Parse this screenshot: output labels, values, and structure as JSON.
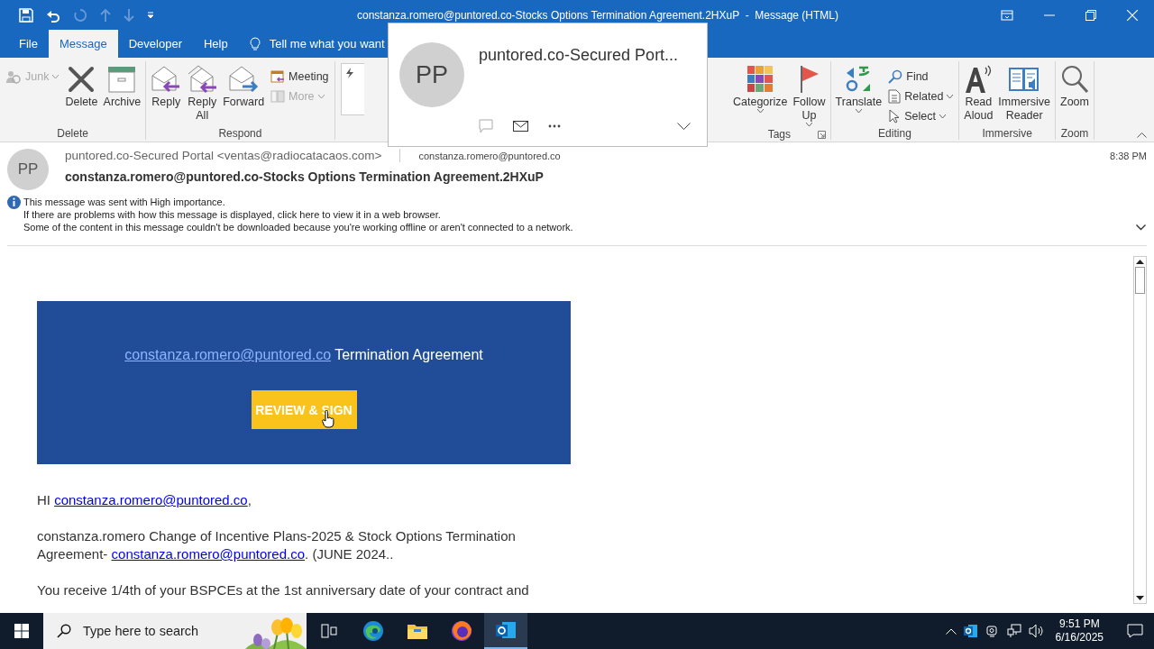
{
  "title_bar": {
    "title": "constanza.romero@puntored.co-Stocks Options Termination Agreement.2HXuP  -  Message (HTML)"
  },
  "tabs": [
    {
      "label": "File",
      "selected": false
    },
    {
      "label": "Message",
      "selected": true
    },
    {
      "label": "Developer",
      "selected": false
    },
    {
      "label": "Help",
      "selected": false
    }
  ],
  "tell_me": {
    "placeholder": "Tell me what you want"
  },
  "ribbon": {
    "left_groups": [
      {
        "label": "Delete",
        "items": [
          {
            "label": "Junk",
            "kind": "small",
            "disabled": true,
            "dropdown": true
          },
          {
            "label": "Delete",
            "kind": "large",
            "disabled": false,
            "dropdown": false
          },
          {
            "label": "Archive",
            "kind": "large",
            "disabled": false,
            "dropdown": false
          }
        ]
      },
      {
        "label": "Respond",
        "items": [
          {
            "label": "Reply",
            "kind": "large",
            "disabled": false,
            "dropdown": false
          },
          {
            "label": "Reply All",
            "kind": "large",
            "disabled": false,
            "dropdown": false
          },
          {
            "label": "Forward",
            "kind": "large",
            "disabled": false,
            "dropdown": false
          },
          {
            "label": "Meeting",
            "kind": "small",
            "disabled": false,
            "dropdown": false
          },
          {
            "label": "More",
            "kind": "small",
            "disabled": true,
            "dropdown": true
          }
        ]
      }
    ],
    "right_groups": [
      {
        "label": "Tags",
        "dialog_launcher": true,
        "items": [
          {
            "label": "Categorize",
            "kind": "large",
            "disabled": false,
            "dropdown": true
          },
          {
            "label": "Follow Up",
            "kind": "large",
            "disabled": false,
            "dropdown": true
          }
        ]
      },
      {
        "label": "Editing",
        "items": [
          {
            "label": "Translate",
            "kind": "large",
            "disabled": false,
            "dropdown": true
          },
          {
            "label": "Find",
            "kind": "small",
            "disabled": false,
            "dropdown": false
          },
          {
            "label": "Related",
            "kind": "small",
            "disabled": false,
            "dropdown": true
          },
          {
            "label": "Select",
            "kind": "small",
            "disabled": false,
            "dropdown": true
          }
        ]
      },
      {
        "label": "Immersive",
        "items": [
          {
            "label": "Read Aloud",
            "kind": "large",
            "disabled": false,
            "dropdown": false
          },
          {
            "label": "Immersive Reader",
            "kind": "large",
            "disabled": false,
            "dropdown": false
          }
        ]
      },
      {
        "label": "Zoom",
        "items": [
          {
            "label": "Zoom",
            "kind": "large",
            "disabled": false,
            "dropdown": false
          }
        ]
      }
    ]
  },
  "contact_card": {
    "initials": "PP",
    "name": "puntored.co-Secured Port..."
  },
  "message": {
    "initials": "PP",
    "sender": "puntored.co-Secured Portal <ventas@radiocatacaos.com>",
    "to": "constanza.romero@puntored.co",
    "time": "8:38 PM",
    "subject": "constanza.romero@puntored.co-Stocks Options Termination Agreement.2HXuP",
    "info": [
      "This message was sent with High importance.",
      "If there are problems with how this message is displayed, click here to view it in a web browser.",
      "Some of the content in this message couldn't be downloaded because you're working offline or aren't connected to a network."
    ]
  },
  "body": {
    "banner": {
      "link": "constanza.romero@puntored.co",
      "title": " Termination Agreement",
      "button": "REVIEW & SIGN"
    },
    "paragraphs": [
      {
        "parts": [
          {
            "kind": "text",
            "text": "HI "
          },
          {
            "kind": "link",
            "text": "constanza.romero@puntored.co"
          },
          {
            "kind": "text",
            "text": ","
          }
        ]
      },
      {
        "parts": [
          {
            "kind": "text",
            "text": "constanza.romero Change of Incentive Plans-2025 & Stock Options Termination Agreement- "
          },
          {
            "kind": "link",
            "text": "constanza.romero@puntored.co"
          },
          {
            "kind": "text",
            "text": ". (JUNE 2024.."
          }
        ]
      },
      {
        "parts": [
          {
            "kind": "text",
            "text": "You receive 1/4th of your BSPCEs at the 1st anniversary date of your contract and"
          }
        ]
      }
    ]
  },
  "taskbar": {
    "search": {
      "placeholder": "Type here to search"
    },
    "apps": [
      {
        "selected": false
      },
      {
        "selected": false
      },
      {
        "selected": false
      },
      {
        "selected": false
      },
      {
        "selected": true
      }
    ],
    "clock": {
      "time": "9:51 PM",
      "date": "6/16/2025"
    }
  }
}
